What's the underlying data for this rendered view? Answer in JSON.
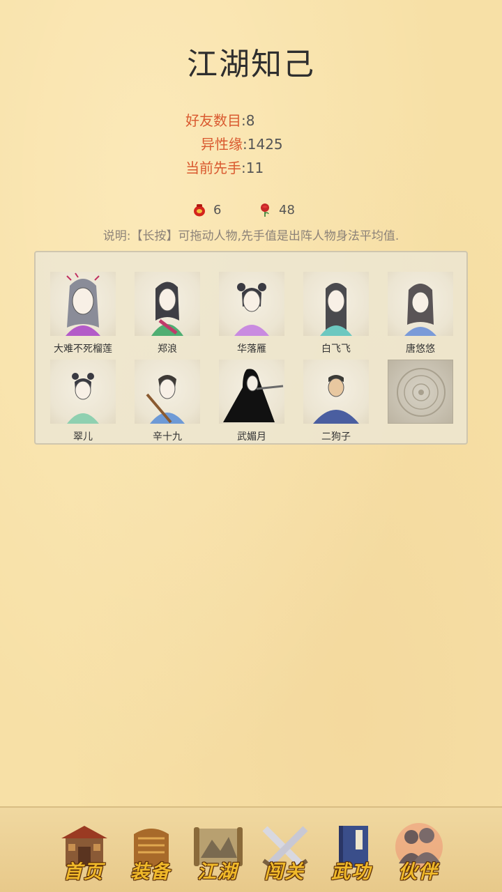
{
  "page": {
    "title": "江湖知己"
  },
  "stats": [
    {
      "key": "好友数目",
      "value": "8"
    },
    {
      "key": "异性缘",
      "value": "1425"
    },
    {
      "key": "当前先手",
      "value": "11"
    }
  ],
  "currency": [
    {
      "icon": "red-pouch-icon",
      "value": "6"
    },
    {
      "icon": "rose-icon",
      "value": "48"
    }
  ],
  "note": "说明:【长按】可拖动人物,先手值是出阵人物身法平均值.",
  "companions": [
    {
      "name": "大难不死榴莲"
    },
    {
      "name": "郑浪"
    },
    {
      "name": "华落雁"
    },
    {
      "name": "白飞飞"
    },
    {
      "name": "唐悠悠"
    },
    {
      "name": "翠儿"
    },
    {
      "name": "辛十九"
    },
    {
      "name": "武媚月"
    },
    {
      "name": "二狗子"
    },
    {
      "name": ""
    }
  ],
  "nav": [
    {
      "label": "首页",
      "icon": "house-icon"
    },
    {
      "label": "装备",
      "icon": "armor-icon"
    },
    {
      "label": "江湖",
      "icon": "scroll-map-icon"
    },
    {
      "label": "闯关",
      "icon": "crossed-swords-icon"
    },
    {
      "label": "武功",
      "icon": "book-icon"
    },
    {
      "label": "伙伴",
      "icon": "companions-icon"
    }
  ]
}
